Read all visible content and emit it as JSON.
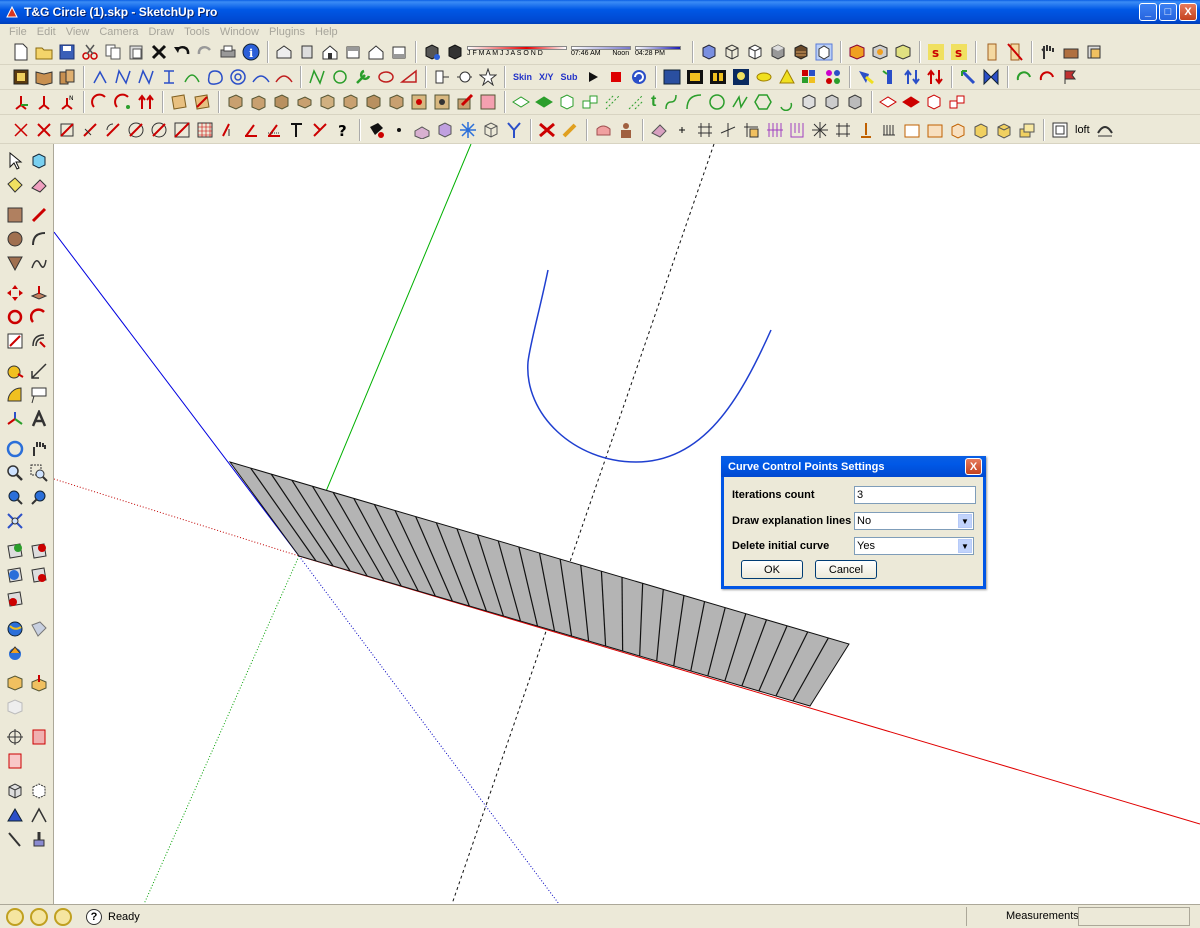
{
  "window": {
    "title": "T&G Circle (1).skp - SketchUp Pro",
    "minimize_label": "_",
    "maximize_label": "□",
    "close_label": "X"
  },
  "menu": [
    "File",
    "Edit",
    "View",
    "Camera",
    "Draw",
    "Tools",
    "Window",
    "Plugins",
    "Help"
  ],
  "shadow_toolbar": {
    "months": "J F M A M J J A S O N D",
    "time_am": "07:46 AM",
    "time_noon": "Noon",
    "time_pm": "04:28 PM"
  },
  "toolbar_labels": {
    "skin": "Skin",
    "xyz": "X/Y",
    "sub": "Sub",
    "loft": "loft",
    "tag_t": "t"
  },
  "dialog": {
    "title": "Curve Control Points Settings",
    "close_label": "X",
    "iterations_label": "Iterations count",
    "iterations_value": "3",
    "explanation_label": "Draw explanation lines",
    "explanation_value": "No",
    "delete_label": "Delete initial curve",
    "delete_value": "Yes",
    "ok_label": "OK",
    "cancel_label": "Cancel"
  },
  "status": {
    "help_glyph": "?",
    "text": "Ready",
    "measurements_label": "Measurements",
    "measurements_value": ""
  },
  "colors": {
    "axis_red": "#e00000",
    "axis_green": "#00b000",
    "axis_blue": "#0000e0",
    "curve_blue": "#1f3fd0",
    "face_gray": "#b4b4b4"
  },
  "help_marker": "?"
}
